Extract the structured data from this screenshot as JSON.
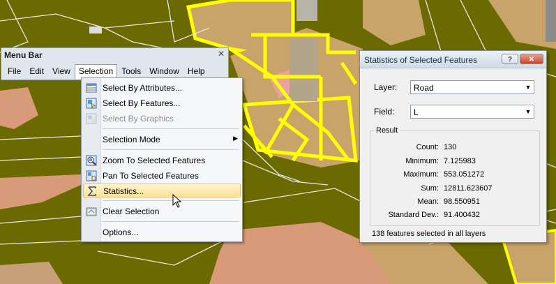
{
  "menubar": {
    "title": "Menu Bar",
    "close": "✕",
    "items": [
      {
        "label": "File"
      },
      {
        "label": "Edit"
      },
      {
        "label": "View"
      },
      {
        "label": "Selection"
      },
      {
        "label": "Tools"
      },
      {
        "label": "Window"
      },
      {
        "label": "Help"
      }
    ]
  },
  "selection_menu": {
    "items": [
      {
        "label": "Select By Attributes...",
        "icon": "table-select-icon",
        "enabled": true
      },
      {
        "label": "Select By Features...",
        "icon": "select-features-icon",
        "enabled": true
      },
      {
        "label": "Select By Graphics",
        "icon": "select-graphics-icon",
        "enabled": false
      },
      {
        "label": "Selection Mode",
        "has_submenu": true
      },
      {
        "label": "Zoom To Selected Features",
        "icon": "zoom-selected-icon"
      },
      {
        "label": "Pan To Selected Features",
        "icon": "pan-selected-icon"
      },
      {
        "label": "Statistics...",
        "icon": "sigma-icon",
        "highlighted": true
      },
      {
        "label": "Clear Selection",
        "icon": "clear-selection-icon"
      },
      {
        "label": "Options..."
      }
    ]
  },
  "stats_dialog": {
    "title": "Statistics of Selected Features",
    "help_button": "?",
    "close_button": "✕",
    "layer_label": "Layer:",
    "layer_value": "Road",
    "field_label": "Field:",
    "field_value": "L",
    "result_label": "Result",
    "stats": [
      {
        "key": "Count:",
        "value": "130"
      },
      {
        "key": "Minimum:",
        "value": "7.125983"
      },
      {
        "key": "Maximum:",
        "value": "553.051272"
      },
      {
        "key": "Sum:",
        "value": "12811.623607"
      },
      {
        "key": "Mean:",
        "value": "98.550951"
      },
      {
        "key": "Standard Dev.:",
        "value": "91.400432"
      }
    ],
    "footer": "138 features selected in all layers"
  },
  "colors": {
    "map_background": "#6b6a00",
    "parcel": "#c9a46a",
    "selection": "#ffff00",
    "road_line": "#e8e8e8",
    "salmon_area": "#d99a7a"
  }
}
